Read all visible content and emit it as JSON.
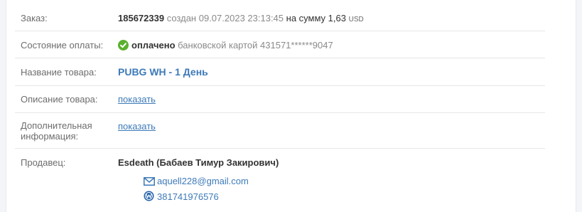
{
  "order": {
    "label": "Заказ:",
    "number": "185672339",
    "created_text": "создан",
    "datetime": "09.07.2023 23:13:45",
    "sum_text": "на сумму",
    "amount": "1,63",
    "currency": "USD"
  },
  "payment": {
    "label": "Состояние оплаты:",
    "status": "оплачено",
    "method": "банковской картой 431571******9047",
    "status_color": "#5ab02e"
  },
  "product": {
    "label": "Название товара:",
    "name": "PUBG WH - 1 День"
  },
  "description": {
    "label": "Описание товара:",
    "link": "показать"
  },
  "additional": {
    "label_line1": "Дополнительная",
    "label_line2": "информация:",
    "link": "показать"
  },
  "seller": {
    "label": "Продавец:",
    "name": "Esdeath (Бабаев Тимур Закирович)",
    "email": "aquell228@gmail.com",
    "email_icon": "envelope-icon",
    "wm_id": "381741976576",
    "wm_icon": "webmoney-icon"
  },
  "colors": {
    "link": "#3d7ab8",
    "label": "#6d6d6d"
  }
}
